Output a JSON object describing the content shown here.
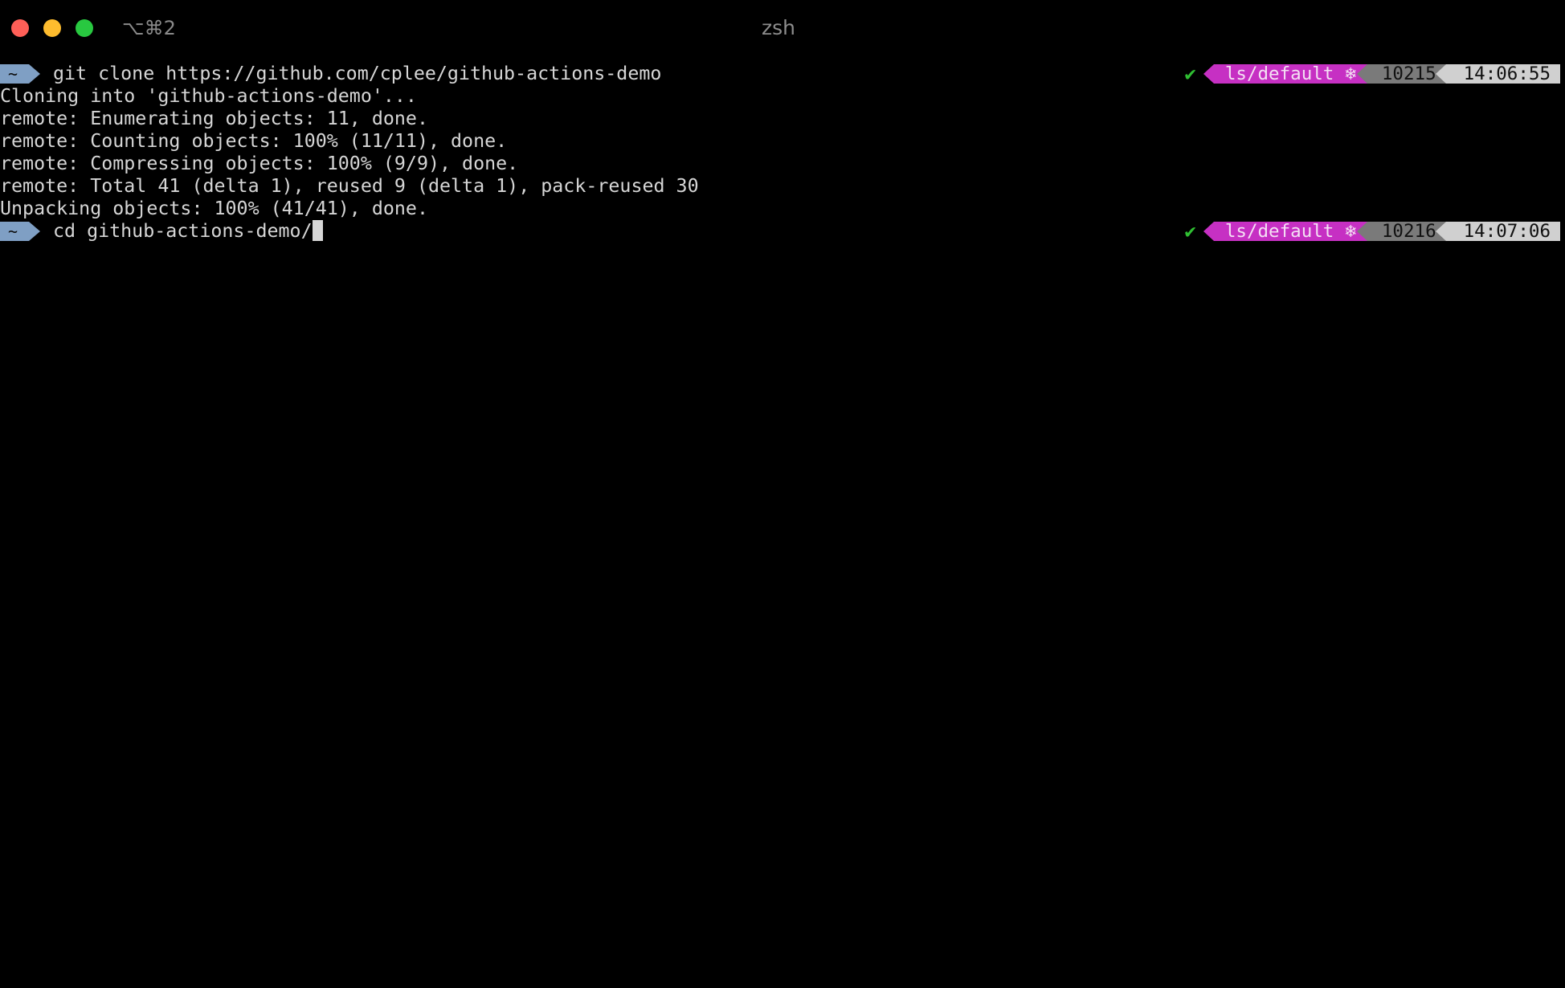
{
  "window": {
    "title": "zsh",
    "shortcut": "⌥⌘2"
  },
  "colors": {
    "prompt_dir_bg": "#7f9fc4",
    "k8s_segment_bg": "#c630c3",
    "history_segment_bg": "#7a7a7a",
    "time_segment_bg": "#d0d0d0",
    "check": "#2fbf32"
  },
  "lines": [
    {
      "type": "prompt",
      "dir": "~",
      "command": "git clone https://github.com/cplee/github-actions-demo",
      "status": "✔",
      "context": "ls/default",
      "context_icon": "❄",
      "history": "10215",
      "time": "14:06:55"
    },
    {
      "type": "output",
      "text": "Cloning into 'github-actions-demo'..."
    },
    {
      "type": "output",
      "text": "remote: Enumerating objects: 11, done."
    },
    {
      "type": "output",
      "text": "remote: Counting objects: 100% (11/11), done."
    },
    {
      "type": "output",
      "text": "remote: Compressing objects: 100% (9/9), done."
    },
    {
      "type": "output",
      "text": "remote: Total 41 (delta 1), reused 9 (delta 1), pack-reused 30"
    },
    {
      "type": "output",
      "text": "Unpacking objects: 100% (41/41), done."
    },
    {
      "type": "prompt",
      "dir": "~",
      "command": "cd github-actions-demo/",
      "status": "✔",
      "context": "ls/default",
      "context_icon": "❄",
      "history": "10216",
      "time": "14:07:06"
    }
  ]
}
